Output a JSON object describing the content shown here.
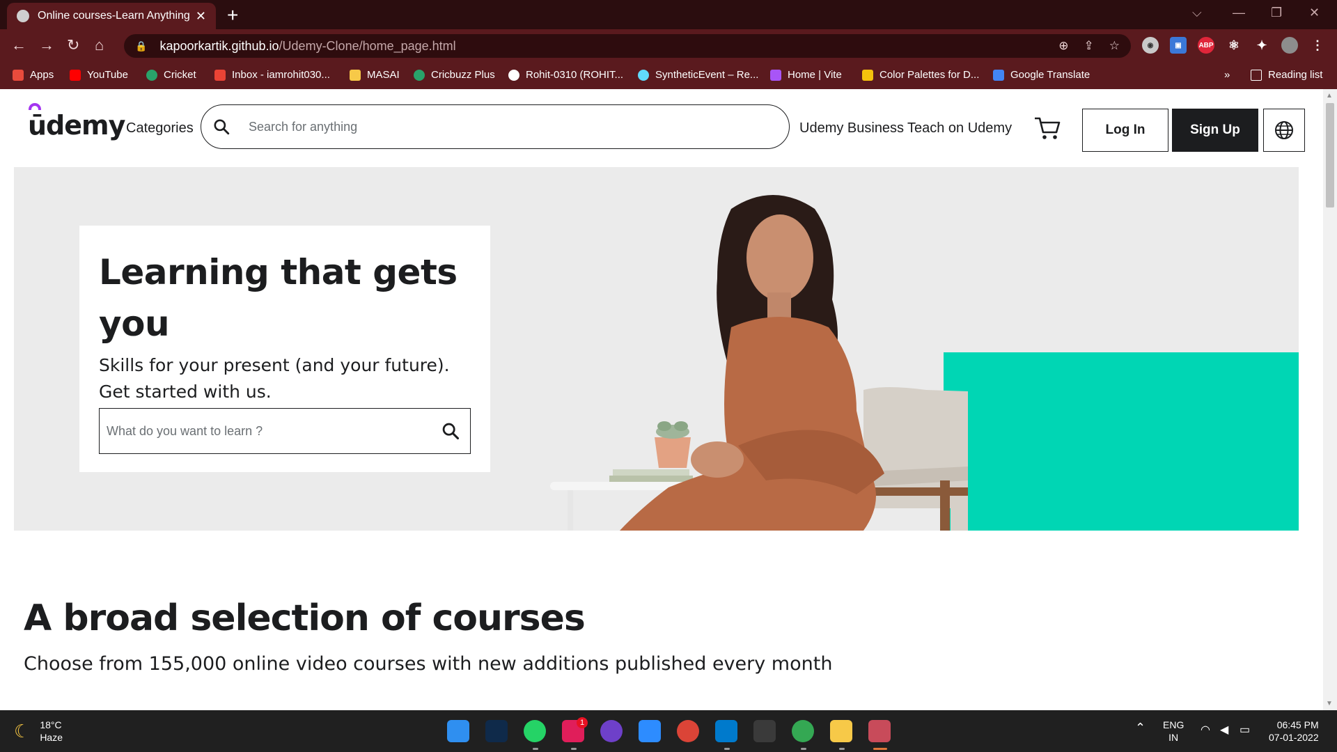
{
  "browser": {
    "tab_title": "Online courses-Learn Anything, C",
    "url_domain": "kapoorkartik.github.io",
    "url_path": "/Udemy-Clone/home_page.html",
    "bookmarks": [
      "Apps",
      "YouTube",
      "Cricket",
      "Inbox - iamrohit030...",
      "MASAI",
      "Cricbuzz Plus",
      "Rohit-0310 (ROHIT...",
      "SyntheticEvent – Re...",
      "Home | Vite",
      "Color Palettes for D...",
      "Google Translate"
    ],
    "more_bookmarks": "»",
    "reading_list": "Reading list",
    "extensions": [
      "ABP"
    ]
  },
  "header": {
    "logo": "ūdemy",
    "categories": "Categories",
    "search_placeholder": "Search for anything",
    "udemy_business": "Udemy Business",
    "teach": "Teach on Udemy",
    "login": "Log In",
    "signup": "Sign Up"
  },
  "hero": {
    "heading": "Learning that gets you",
    "subtext": "Skills for your present (and your future). Get started with us.",
    "search_placeholder": "What do you want to learn ?"
  },
  "section": {
    "title": "A broad selection of courses",
    "subtitle": "Choose from 155,000 online video courses with new additions published every month"
  },
  "taskbar": {
    "temperature": "18°C",
    "weather": "Haze",
    "lang": "ENG",
    "region": "IN",
    "time": "06:45 PM",
    "date": "07-01-2022",
    "slack_badge": "1"
  },
  "colors": {
    "brand_purple": "#a435f0",
    "teal": "#00d6b4",
    "chrome_dark": "#2b0d0f",
    "chrome": "#5a1a1e",
    "text": "#1c1d1f"
  }
}
